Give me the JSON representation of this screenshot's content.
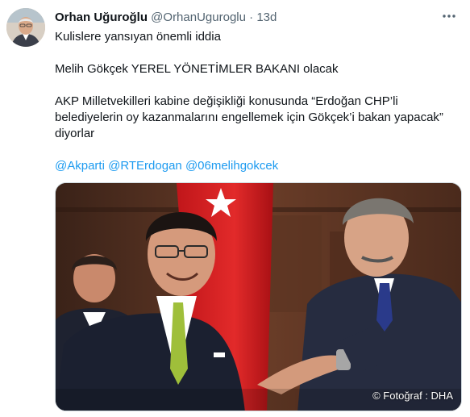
{
  "tweet": {
    "author_name": "Orhan Uğuroğlu",
    "author_handle": "@OrhanUguroglu",
    "separator": "·",
    "time": "13d",
    "lines": [
      "Kulislere yansıyan önemli iddia",
      "Melih Gökçek YEREL YÖNETİMLER BAKANI olacak",
      "AKP Milletvekilleri kabine değişikliği konusunda “Erdoğan CHP’li belediyelerin oy kazanmalarını engellemek için Gökçek’i bakan yapacak” diyorlar"
    ],
    "mentions": [
      "@Akparti",
      "@RTErdogan",
      "@06melihgokcek"
    ],
    "media_credit": "© Fotoğraf : DHA"
  },
  "icons": {
    "more": "more-options-icon"
  },
  "colors": {
    "link": "#1d9bf0",
    "text": "#0f1419",
    "secondary": "#536471"
  }
}
